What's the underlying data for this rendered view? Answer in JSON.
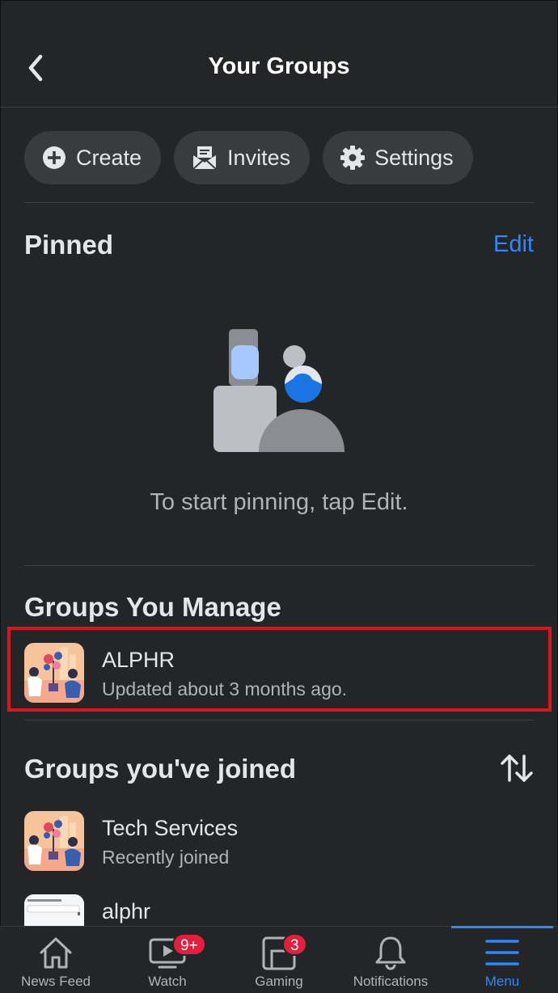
{
  "header": {
    "title": "Your Groups"
  },
  "actions": [
    {
      "label": "Create",
      "icon": "plus-circle-icon"
    },
    {
      "label": "Invites",
      "icon": "envelope-icon"
    },
    {
      "label": "Settings",
      "icon": "gear-icon"
    }
  ],
  "pinned": {
    "title": "Pinned",
    "edit_label": "Edit",
    "empty_message": "To start pinning, tap Edit."
  },
  "manage": {
    "title": "Groups You Manage",
    "groups": [
      {
        "name": "ALPHR",
        "subtitle": "Updated about 3 months ago."
      }
    ]
  },
  "joined": {
    "title": "Groups you've joined",
    "groups": [
      {
        "name": "Tech Services",
        "subtitle": "Recently joined"
      },
      {
        "name": "alphr",
        "subtitle": ""
      }
    ]
  },
  "bottom_nav": [
    {
      "label": "News Feed",
      "icon": "home-icon"
    },
    {
      "label": "Watch",
      "icon": "video-icon",
      "badge": "9+"
    },
    {
      "label": "Gaming",
      "icon": "gaming-icon",
      "badge": "3"
    },
    {
      "label": "Notifications",
      "icon": "bell-icon"
    },
    {
      "label": "Menu",
      "icon": "menu-icon",
      "active": true
    }
  ],
  "colors": {
    "background": "#242526",
    "accent": "#2d88ff",
    "badge": "#e41e3f",
    "highlight": "#e0121a"
  }
}
